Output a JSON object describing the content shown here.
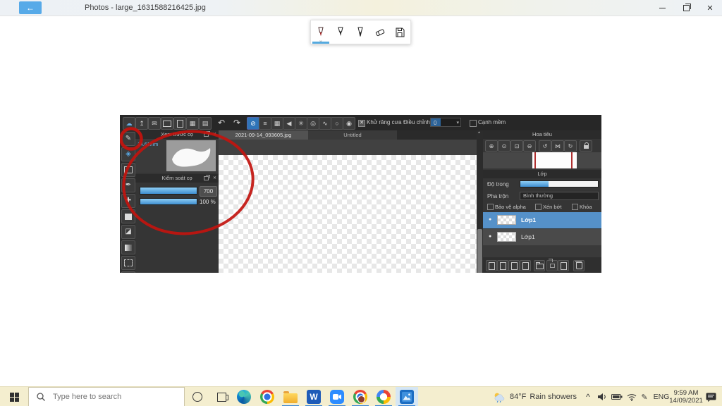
{
  "window": {
    "title": "Photos - large_1631588216425.jpg"
  },
  "icons": {
    "back": "←",
    "close": "✕",
    "panel_close": "✕",
    "tool_chevron": "∨",
    "dropdown_arrow": "▾",
    "scroll_up": "▲",
    "eye_dot": "●",
    "chevron_up": "^"
  },
  "draw_toolbar": {
    "tools": [
      "ballpoint-pen",
      "pencil",
      "calligraphy-pen",
      "eraser",
      "save"
    ],
    "selected_index": 0
  },
  "paint": {
    "tabs": [
      {
        "label": "2021-09-14_093605.jpg",
        "active": true
      },
      {
        "label": "Untitled",
        "active": false
      }
    ],
    "options": {
      "antialias_label": "Khử răng cưa",
      "antialias_checked": true,
      "stabilizer_label": "Điều chỉnh",
      "stabilizer_value": "0",
      "soft_edge_label": "Cạnh mềm",
      "soft_edge_checked": false
    },
    "brush_preview": {
      "title": "Xem trước cọ",
      "brush_size": "14.61mm"
    },
    "brush_control": {
      "title": "Kiểm soát cọ",
      "size_value": "700",
      "opacity_value": "100 %"
    },
    "navigator": {
      "title": "Hoa tiêu"
    },
    "layers_panel": {
      "title": "Lớp",
      "opacity_label": "Độ trong",
      "blend_label": "Pha trộn",
      "blend_value": "Bình thường",
      "alpha_lock_label": "Bảo vệ alpha",
      "clipping_label": "Xén bớt",
      "lock_label": "Khóa",
      "layers": [
        {
          "name": "Lớp1",
          "selected": true
        },
        {
          "name": "Lớp1",
          "selected": false
        }
      ]
    },
    "colors": {
      "slider_blue": "#4b9fe0",
      "selected_layer": "#5591c9",
      "annotation_red": "#c2130e"
    }
  },
  "taskbar": {
    "search_placeholder": "Type here to search",
    "weather_temp": "84°F",
    "weather_desc": "Rain showers",
    "language": "ENG",
    "time": "9:59 AM",
    "date": "14/09/2021"
  }
}
